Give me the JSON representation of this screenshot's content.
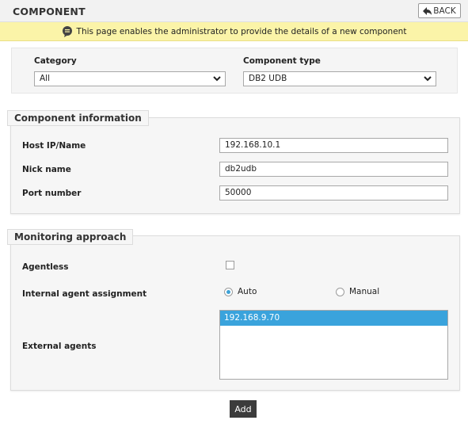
{
  "header": {
    "title": "COMPONENT",
    "back_label": "BACK"
  },
  "notice": {
    "text": "This page enables the administrator to provide the details of a new component"
  },
  "filters": {
    "category_label": "Category",
    "category_value": "All",
    "component_type_label": "Component type",
    "component_type_value": "DB2 UDB"
  },
  "component_info": {
    "legend": "Component information",
    "host_label": "Host IP/Name",
    "host_value": "192.168.10.1",
    "nick_label": "Nick name",
    "nick_value": "db2udb",
    "port_label": "Port number",
    "port_value": "50000"
  },
  "monitoring": {
    "legend": "Monitoring approach",
    "agentless_label": "Agentless",
    "agentless_checked": false,
    "internal_label": "Internal agent assignment",
    "radio_auto": "Auto",
    "radio_manual": "Manual",
    "selected_assignment": "Auto",
    "external_label": "External agents",
    "external_agents": [
      "192.168.9.70"
    ]
  },
  "actions": {
    "add_label": "Add"
  },
  "icons": {
    "back": "back-arrow-icon",
    "notice": "speech-bubble-icon",
    "dropdown": "chevron-down-icon"
  },
  "colors": {
    "notice_bg": "#fbf4a8",
    "selection": "#3aa3dc",
    "add_button": "#3c3c3c"
  }
}
